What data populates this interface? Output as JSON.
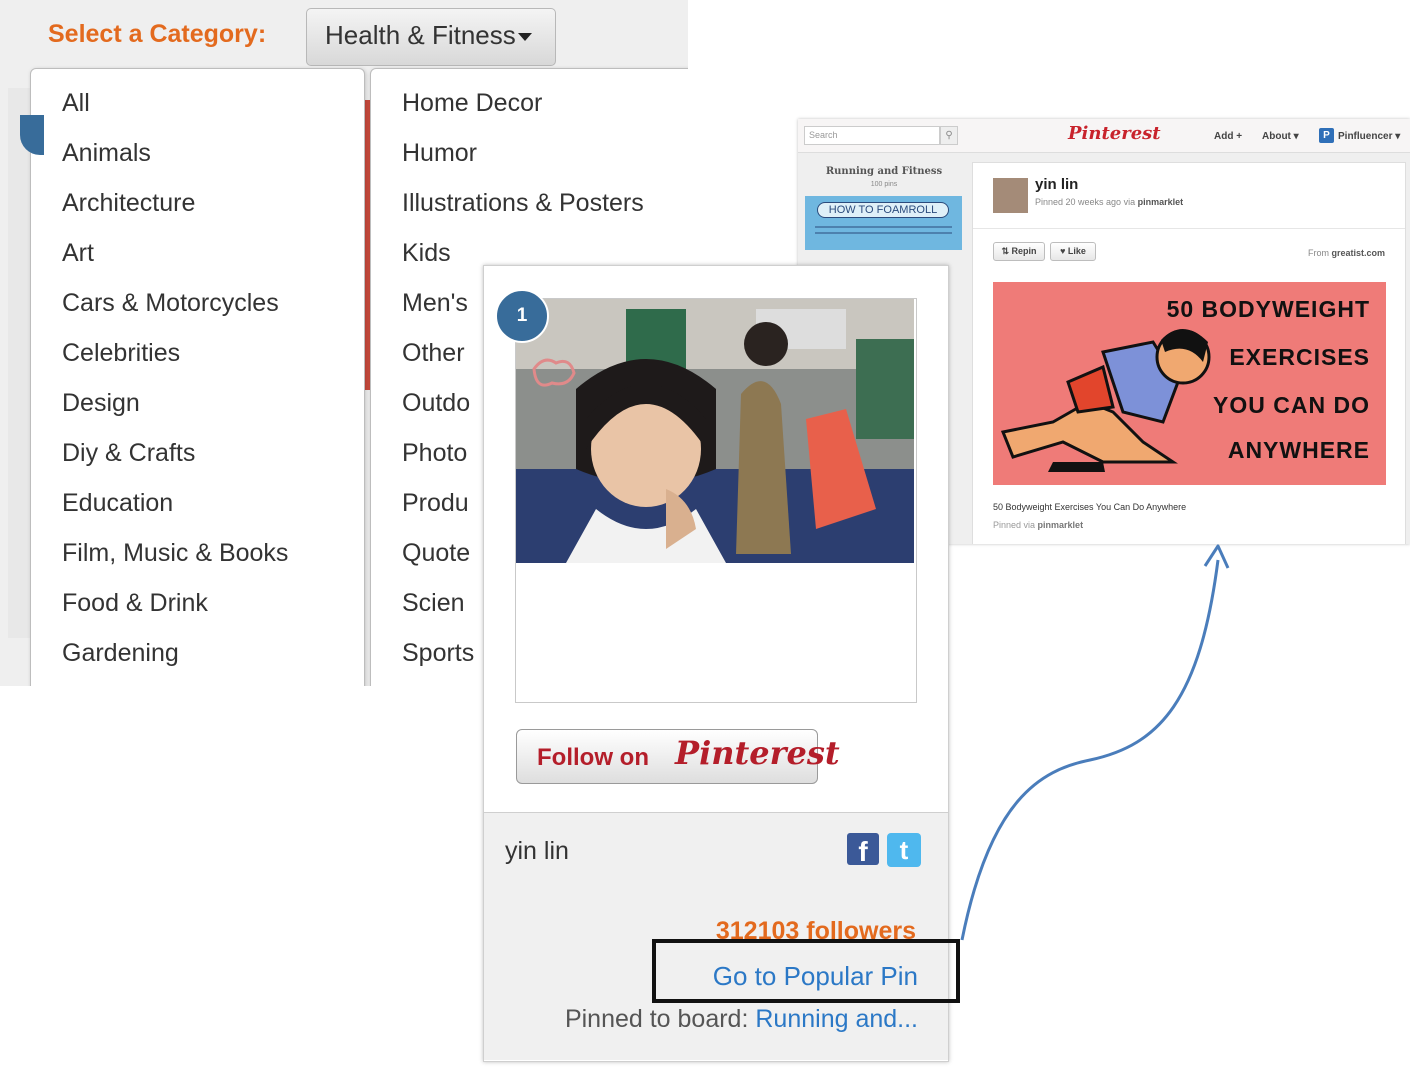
{
  "category_picker": {
    "label": "Select a Category:",
    "selected": "Health & Fitness",
    "column_left": [
      "All",
      "Animals",
      "Architecture",
      "Art",
      "Cars & Motorcycles",
      "Celebrities",
      "Design",
      "Diy & Crafts",
      "Education",
      "Film, Music & Books",
      "Food & Drink",
      "Gardening"
    ],
    "column_right": [
      "Home Decor",
      "Humor",
      "Illustrations & Posters",
      "Kids",
      "Men's",
      "Other",
      "Outdo",
      "Photo",
      "Produ",
      "Quote",
      "Scien",
      "Sports"
    ]
  },
  "widget": {
    "rank": "1",
    "follow_button": {
      "prefix": "Follow on",
      "brand": "Pinterest"
    },
    "user_name": "yin lin",
    "social_icons": [
      "facebook-icon",
      "twitter-icon"
    ],
    "followers": "312103 followers",
    "popular_pin_link": "Go to Popular Pin",
    "pinned_to_label": "Pinned to board:",
    "board_link": "Running and..."
  },
  "pinterest_page": {
    "search_placeholder": "Search",
    "logo": "Pinterest",
    "nav": {
      "add": "Add",
      "about": "About",
      "user": "Pinfluencer"
    },
    "board": {
      "title": "Running and Fitness",
      "count": "100 pins",
      "thumb_text": "HOW TO FOAMROLL"
    },
    "pin": {
      "user": "yin lin",
      "meta_prefix": "Pinned 20 weeks ago via",
      "meta_source": "pinmarklet",
      "repin": "Repin",
      "like": "Like",
      "from_prefix": "From",
      "from_domain": "greatist.com",
      "image_lines": [
        "50 BODYWEIGHT",
        "EXERCISES",
        "YOU CAN DO",
        "ANYWHERE"
      ],
      "caption": "50 Bodyweight Exercises You Can Do Anywhere",
      "via_prefix": "Pinned via",
      "via_source": "pinmarklet"
    }
  },
  "colors": {
    "accent_orange": "#e36a1e",
    "link_blue": "#2b78c6",
    "pinterest_red": "#c8232c",
    "arrow_blue": "#4a7dbb",
    "pin_image_bg": "#ef7b78"
  }
}
